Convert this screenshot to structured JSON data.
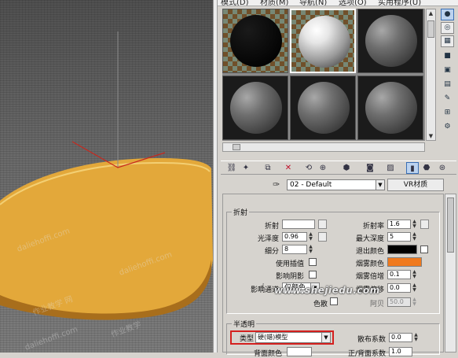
{
  "viewport": {
    "watermarks": [
      "daliehoffi.com",
      "作业教学 网",
      "daliehoffi.com",
      "作业教学",
      "daliehoffi.com"
    ]
  },
  "menu": {
    "items": [
      "模式(D)",
      "材质(M)",
      "导航(N)",
      "选项(O)",
      "实用程序(U)"
    ]
  },
  "slots": [
    {
      "kind": "black",
      "selected": false
    },
    {
      "kind": "white",
      "selected": true
    },
    {
      "kind": "gray",
      "selected": false
    },
    {
      "kind": "gray",
      "selected": false
    },
    {
      "kind": "gray",
      "selected": false
    },
    {
      "kind": "gray",
      "selected": false
    }
  ],
  "side_tools": [
    "sphere-icon",
    "cylinder-icon",
    "checker-icon",
    "backlight-icon",
    "background-icon",
    "uv-tiling-icon",
    "video-color-icon",
    "make-preview-icon",
    "options-icon",
    "select-by-material-icon",
    "material-map-navigator-icon"
  ],
  "toolbar": {
    "icons": [
      "get-material-icon",
      "put-to-scene-icon",
      "assign-to-selection-icon",
      "reset-map-icon",
      "make-unique-icon",
      "put-to-library-icon",
      "material-id-icon",
      "show-map-icon",
      "show-end-result-icon",
      "go-to-parent-icon",
      "go-forward-icon"
    ]
  },
  "material": {
    "name": "02 - Default",
    "type": "VR材质"
  },
  "refraction": {
    "title": "折射",
    "refract_label": "折射",
    "glossiness_label": "光泽度",
    "glossiness_value": "0.96",
    "subdivs_label": "细分",
    "subdivs_value": "8",
    "use_interp_label": "使用插值",
    "affect_shadows_label": "影响阴影",
    "affect_channels_label": "影响通道",
    "affect_channels_value": "仅颜色",
    "dispersion_label": "色散",
    "ior_label": "折射率",
    "ior_value": "1.6",
    "max_depth_label": "最大深度",
    "max_depth_value": "5",
    "exit_color_label": "退出颜色",
    "fog_color_label": "烟雾颜色",
    "fog_mult_label": "烟雾倍增",
    "fog_mult_value": "0.1",
    "fog_bias_label": "烟雾偏移",
    "fog_bias_value": "0.0",
    "abbe_label": "阿贝",
    "abbe_value": "50.0",
    "colors": {
      "refract": "#ffffff",
      "exit": "#000000",
      "fog": "#f07a1e"
    }
  },
  "translucency": {
    "title": "半透明",
    "type_label": "类型",
    "type_value": "硬(蜡)模型",
    "scatter_label": "散布系数",
    "scatter_value": "0.0",
    "back_label": "背面颜色",
    "fwd_label": "正/背面系数",
    "fwd_value": "1.0"
  },
  "site_watermark": "www.shejiedu.com"
}
